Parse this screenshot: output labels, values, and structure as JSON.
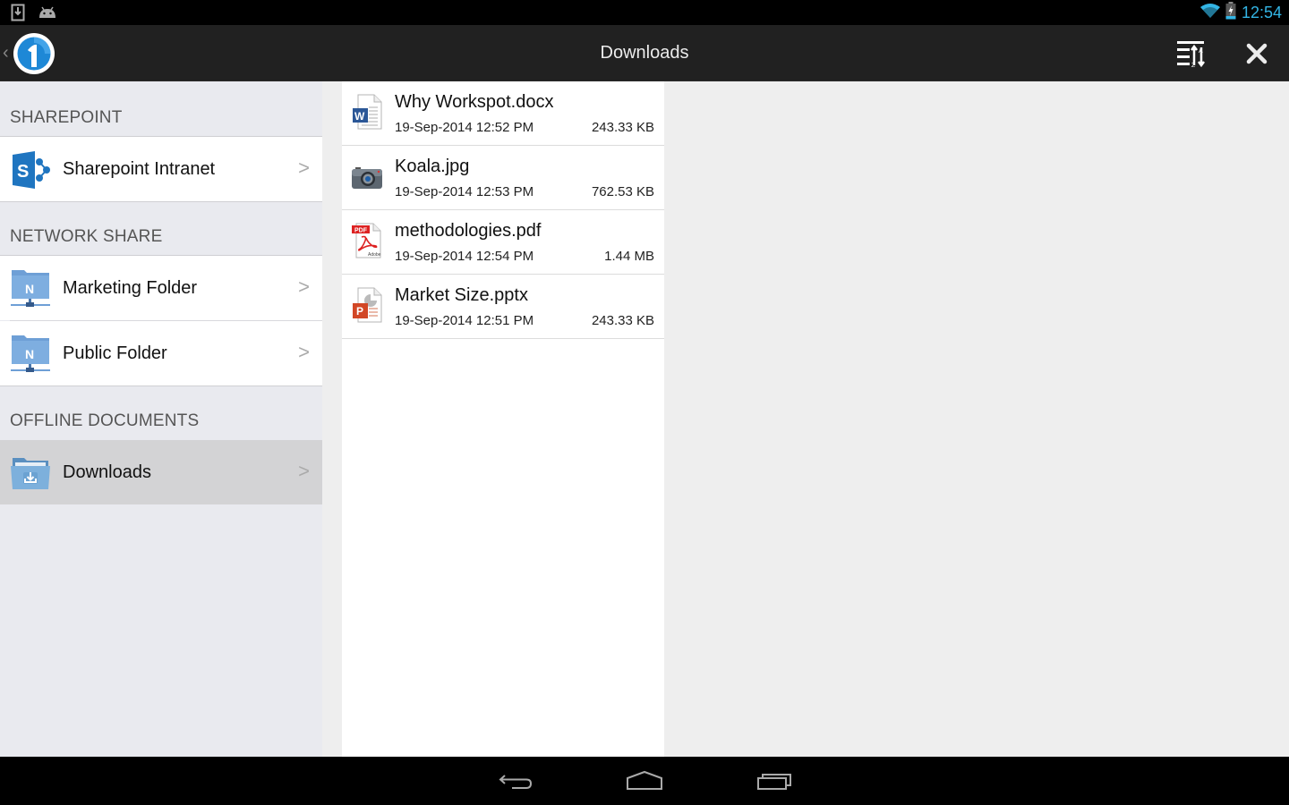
{
  "status_bar": {
    "time": "12:54",
    "left_icons": [
      "download-notification-icon",
      "android-debug-icon"
    ],
    "right_icons": [
      "wifi-icon",
      "battery-charging-icon"
    ],
    "accent_color": "#33b5e5"
  },
  "action_bar": {
    "title": "Downloads",
    "logo": "app-logo-icon",
    "actions": [
      {
        "name": "sort",
        "icon": "sort-az-icon"
      },
      {
        "name": "close",
        "icon": "close-icon"
      }
    ]
  },
  "sidebar": {
    "sections": [
      {
        "header": "SHAREPOINT",
        "items": [
          {
            "label": "Sharepoint Intranet",
            "icon": "sharepoint-icon",
            "selected": false
          }
        ]
      },
      {
        "header": "NETWORK SHARE",
        "items": [
          {
            "label": "Marketing Folder",
            "icon": "network-folder-icon",
            "selected": false
          },
          {
            "label": "Public Folder",
            "icon": "network-folder-icon",
            "selected": false
          }
        ]
      },
      {
        "header": "OFFLINE DOCUMENTS",
        "items": [
          {
            "label": "Downloads",
            "icon": "download-folder-icon",
            "selected": true
          }
        ]
      }
    ]
  },
  "files": [
    {
      "name": "Why Workspot.docx",
      "date": "19-Sep-2014 12:52 PM",
      "size": "243.33 KB",
      "type": "word"
    },
    {
      "name": "Koala.jpg",
      "date": "19-Sep-2014 12:53 PM",
      "size": "762.53 KB",
      "type": "image"
    },
    {
      "name": "methodologies.pdf",
      "date": "19-Sep-2014 12:54 PM",
      "size": "1.44 MB",
      "type": "pdf"
    },
    {
      "name": "Market Size.pptx",
      "date": "19-Sep-2014 12:51 PM",
      "size": "243.33 KB",
      "type": "powerpoint"
    }
  ],
  "nav_bar": {
    "buttons": [
      "back",
      "home",
      "recents"
    ]
  }
}
